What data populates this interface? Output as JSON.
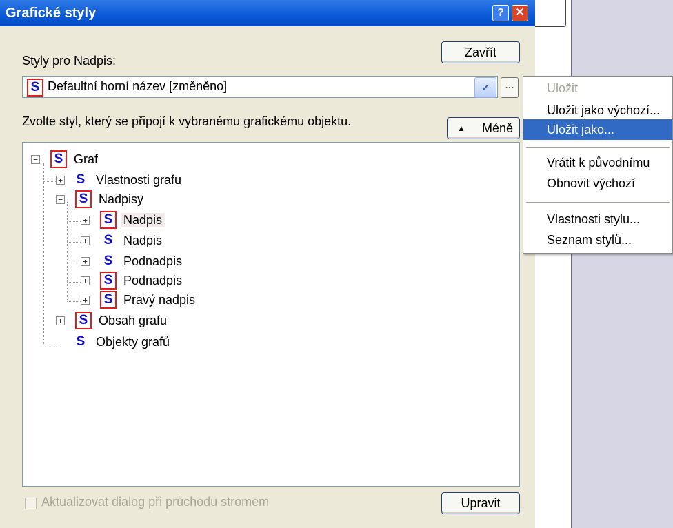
{
  "dialog": {
    "title": "Grafické styly",
    "help_button": "?",
    "close_button": "✕",
    "styles_for_label": "Styly pro Nadpis:",
    "close_label": "Zavřít",
    "style_combo_value": "Defaultní horní název [změněno]",
    "ellipsis_label": "...",
    "instruction": "Zvolte styl, který se připojí k vybranému grafickému objektu.",
    "less_label": "Méně",
    "less_icon": "chevron-up-icon",
    "checkbox_label": "Aktualizovat dialog při průchodu stromem",
    "edit_label": "Upravit"
  },
  "tree": {
    "style_glyph": "S",
    "nodes": [
      {
        "label": "Graf",
        "level": 0,
        "expander": "minus",
        "boxed": true
      },
      {
        "label": "Vlastnosti grafu",
        "level": 1,
        "expander": "plus",
        "boxed": false
      },
      {
        "label": "Nadpisy",
        "level": 1,
        "expander": "minus",
        "boxed": true
      },
      {
        "label": "Nadpis",
        "level": 2,
        "expander": "plus",
        "boxed": true,
        "selected": true
      },
      {
        "label": "Nadpis",
        "level": 2,
        "expander": "plus",
        "boxed": false
      },
      {
        "label": "Podnadpis",
        "level": 2,
        "expander": "plus",
        "boxed": false
      },
      {
        "label": "Podnadpis",
        "level": 2,
        "expander": "plus",
        "boxed": true
      },
      {
        "label": "Pravý nadpis",
        "level": 2,
        "expander": "plus",
        "boxed": true
      },
      {
        "label": "Obsah grafu",
        "level": 1,
        "expander": "plus",
        "boxed": true
      },
      {
        "label": "Objekty grafů",
        "level": 1,
        "expander": "none",
        "boxed": false
      }
    ]
  },
  "menu": {
    "items": [
      {
        "label": "Uložit",
        "state": "disabled"
      },
      {
        "label": "Uložit jako výchozí...",
        "state": "normal"
      },
      {
        "label": "Uložit jako...",
        "state": "highlighted"
      },
      {
        "label": "Vrátit k původnímu",
        "state": "normal"
      },
      {
        "label": "Obnovit výchozí",
        "state": "normal"
      },
      {
        "label": "Vlastnosti stylu...",
        "state": "normal"
      },
      {
        "label": "Seznam stylů...",
        "state": "normal"
      }
    ]
  },
  "colors": {
    "titlebar": "#0a5ad8",
    "highlight": "#316ac5",
    "style_glyph": "#1010c8",
    "style_box_border": "#e02020"
  }
}
